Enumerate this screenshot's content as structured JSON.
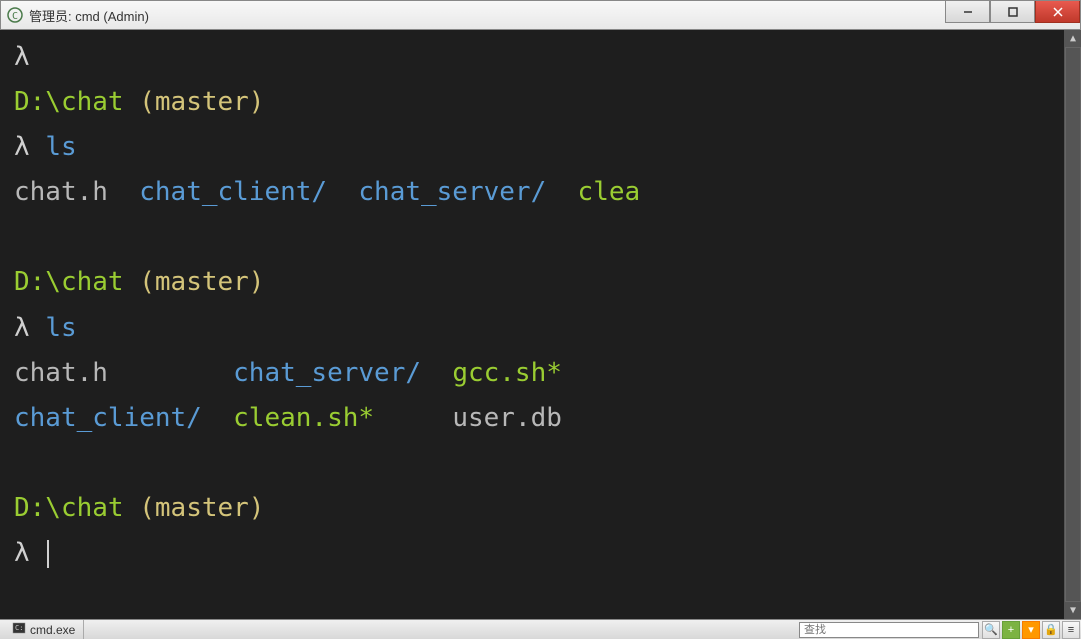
{
  "titlebar": {
    "title": "管理员: cmd (Admin)"
  },
  "terminal": {
    "lines": [
      {
        "segments": [
          {
            "text": "λ",
            "cls": "c-white"
          }
        ]
      },
      {
        "segments": [
          {
            "text": "D:\\chat ",
            "cls": "c-green"
          },
          {
            "text": "(master)",
            "cls": "c-yellow"
          }
        ]
      },
      {
        "segments": [
          {
            "text": "λ ",
            "cls": "c-white"
          },
          {
            "text": "ls",
            "cls": "c-blue"
          }
        ]
      },
      {
        "segments": [
          {
            "text": "chat.h  ",
            "cls": "c-gray"
          },
          {
            "text": "chat_client/",
            "cls": "c-blue"
          },
          {
            "text": "  ",
            "cls": "c-gray"
          },
          {
            "text": "chat_server/",
            "cls": "c-blue"
          },
          {
            "text": "  ",
            "cls": "c-gray"
          },
          {
            "text": "clea",
            "cls": "c-green"
          }
        ]
      },
      {
        "segments": [
          {
            "text": " ",
            "cls": "c-gray"
          }
        ]
      },
      {
        "segments": [
          {
            "text": "D:\\chat ",
            "cls": "c-green"
          },
          {
            "text": "(master)",
            "cls": "c-yellow"
          }
        ]
      },
      {
        "segments": [
          {
            "text": "λ ",
            "cls": "c-white"
          },
          {
            "text": "ls",
            "cls": "c-blue"
          }
        ]
      },
      {
        "segments": [
          {
            "text": "chat.h        ",
            "cls": "c-gray"
          },
          {
            "text": "chat_server/",
            "cls": "c-blue"
          },
          {
            "text": "  ",
            "cls": "c-gray"
          },
          {
            "text": "gcc.sh*",
            "cls": "c-green"
          }
        ]
      },
      {
        "segments": [
          {
            "text": "chat_client/",
            "cls": "c-blue"
          },
          {
            "text": "  ",
            "cls": "c-gray"
          },
          {
            "text": "clean.sh*",
            "cls": "c-green"
          },
          {
            "text": "     ",
            "cls": "c-gray"
          },
          {
            "text": "user.db",
            "cls": "c-gray"
          }
        ]
      },
      {
        "segments": [
          {
            "text": " ",
            "cls": "c-gray"
          }
        ]
      },
      {
        "segments": [
          {
            "text": "D:\\chat ",
            "cls": "c-green"
          },
          {
            "text": "(master)",
            "cls": "c-yellow"
          }
        ]
      },
      {
        "segments": [
          {
            "text": "λ ",
            "cls": "c-white"
          }
        ],
        "cursor": true
      }
    ]
  },
  "statusbar": {
    "tab": "cmd.exe",
    "search_placeholder": "查找"
  }
}
